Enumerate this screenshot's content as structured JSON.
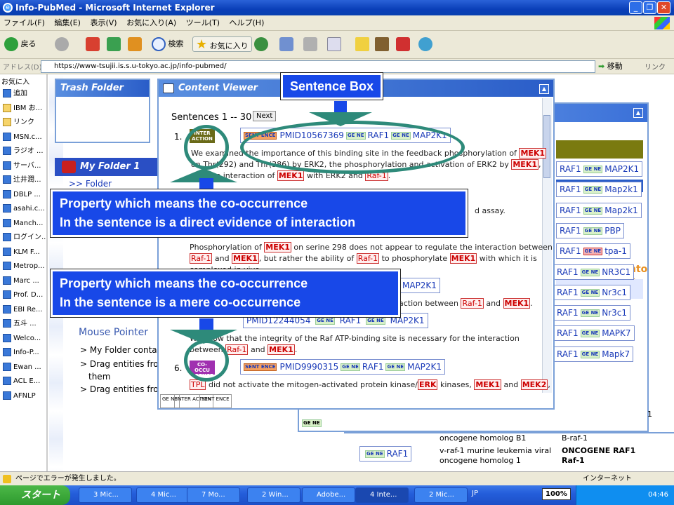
{
  "window": {
    "title": "Info-PubMed - Microsoft Internet Explorer",
    "logo": "e"
  },
  "menu": [
    "ファイル(F)",
    "編集(E)",
    "表示(V)",
    "お気に入り(A)",
    "ツール(T)",
    "ヘルプ(H)"
  ],
  "toolbar": {
    "back": "戻る",
    "search": "検索",
    "favorites": "お気に入り"
  },
  "address": {
    "label": "アドレス(D)",
    "url": "https://www-tsujii.is.s.u-tokyo.ac.jp/info-pubmed/",
    "go": "移動",
    "links": "リンク"
  },
  "favorites": {
    "title": "お気に入",
    "items": [
      "追加",
      "IBM お...",
      "リンク",
      "MSN.c...",
      "ラジオ ...",
      "サーバ...",
      "辻井潤...",
      "DBLP ...",
      "asahi.c...",
      "Manch...",
      "ログイン...",
      "KLM F...",
      "Metrop...",
      "Marc ...",
      "Prof. D...",
      "EBI Re...",
      "五斗 ...",
      "Welco...",
      "Info-P...",
      "Ewan ...",
      "ACL E...",
      "AFNLP"
    ]
  },
  "panels": {
    "trash": "Trash Folder",
    "my_folder": "My Folder 1",
    "folder_link": ">> Folder",
    "content_viewer": "Content Viewer"
  },
  "help": {
    "title": "Mouse Pointer",
    "lines": [
      "> My Folder conta",
      "> Drag entities fro",
      "them",
      "> Drag entities fro"
    ]
  },
  "content": {
    "header": "Sentences 1 -- 30",
    "next": "Next",
    "row1": {
      "num": "1.",
      "pmid": "PMID10567369",
      "gene1": "RAF1",
      "gene2": "MAP2K1"
    },
    "text1a": "We examined the importance of this binding site in the feedback phosphorylation of",
    "text1b": "on Thr(292) and Thr(386) by ERK2, the phosphorylation and activation of ERK2 by",
    "text1c": "and the interaction of",
    "text1d": "with ERK2 and",
    "text2": "d assay.",
    "text3a": "Phosphorylation of",
    "text3b": "on serine 298 does not appear to regulate the interaction between",
    "text3c": "and",
    "text3d": ", but rather the ability of",
    "text3e": "to phosphorylate",
    "text3f": "with which it is",
    "text3g": "complexed in vivo.",
    "text4": "action between",
    "pmid5": "PMID12244054",
    "text5a": "We show that the integrity of the Raf ATP-binding site is necessary for the interaction",
    "text5b": "between",
    "row6": {
      "num": "6.",
      "badge": "CO-OCCU RRENCE",
      "pmid": "PMID9990315",
      "gene1": "RAF1",
      "gene2": "MAP2K1"
    },
    "text6a": "did not activate the mitogen-activated protein kinase/",
    "text6b": "kinases,",
    "tags": {
      "mek": "MEK1",
      "mek2": "MEK2",
      "raf": "Raf-1",
      "erk": "ERK",
      "tpl": "TPL"
    },
    "inter_badge": "INTER ACTION",
    "sent_tag": "SENT ENCE",
    "ge_tag": "GE NE",
    "map2k1": "MAP2K1",
    "bottom_tabs": [
      "GE NE",
      "INTER ACTION",
      "SENT ENCE"
    ]
  },
  "right_panel": {
    "rows": [
      {
        "a": "RAF1",
        "b": "MAP2K1",
        "red": false
      },
      {
        "a": "RAF1",
        "b": "Map2k1",
        "red": false
      },
      {
        "a": "RAF1",
        "b": "Map2k1",
        "red": false
      },
      {
        "a": "RAF1",
        "b": "PBP",
        "red": false
      },
      {
        "a": "RAF1",
        "b": "tpa-1",
        "red": true
      },
      {
        "a": "RAF1",
        "b": "NR3C1",
        "red": false
      },
      {
        "a": "RAF1",
        "b": "Nr3c1",
        "red": false
      },
      {
        "a": "RAF1",
        "b": "Nr3c1",
        "red": false
      },
      {
        "a": "RAF1",
        "b": "MAPK7",
        "red": false
      },
      {
        "a": "RAF1",
        "b": "Mapk7",
        "red": false
      }
    ],
    "side_text": "nto o",
    "bottom": {
      "num": "1",
      "row1_desc": "oncogene homolog B1",
      "row1_sym": "B-raf-1",
      "gene": "RAF1",
      "row2_desc1": "v-raf-1 murine leukemia viral",
      "row2_desc2": "oncogene homolog 1",
      "row2_sym1": "ONCOGENE RAF1",
      "row2_sym2": "Raf-1"
    }
  },
  "callouts": {
    "sentence_box": "Sentence Box",
    "interaction_line1": "Property which means the co-occurrence",
    "interaction_line2": "In the sentence is a direct evidence of interaction",
    "cooccur_line1": "Property which means the co-occurrence",
    "cooccur_line2": "In the sentence is  a mere co-occurrence",
    "callout_color": "#1848e8"
  },
  "statusbar": {
    "text": "ページでエラーが発生しました。",
    "zone": "インターネット"
  },
  "taskbar": {
    "start": "スタート",
    "tasks": [
      "3 Mic...",
      "4 Mic...",
      "7 Mo...",
      "2 Win...",
      "Adobe...",
      "4 Inte...",
      "2 Mic..."
    ],
    "lang": "JP",
    "zoom": "100%",
    "clock": "04:46"
  }
}
